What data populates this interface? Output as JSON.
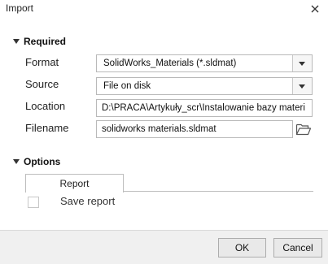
{
  "dialog": {
    "title": "Import"
  },
  "required": {
    "heading": "Required",
    "format": {
      "label": "Format",
      "value": "SolidWorks_Materials (*.sldmat)"
    },
    "source": {
      "label": "Source",
      "value": "File on disk"
    },
    "location": {
      "label": "Location",
      "value": "D:\\PRACA\\Artykuły_scr\\Instalowanie bazy materi"
    },
    "filename": {
      "label": "Filename",
      "value": "solidworks materials.sldmat"
    }
  },
  "options": {
    "heading": "Options",
    "tabs": [
      {
        "label": "Report"
      }
    ],
    "save_report": {
      "label": "Save report",
      "checked": false
    }
  },
  "buttons": {
    "ok": "OK",
    "cancel": "Cancel"
  },
  "icons": {
    "close": "close-icon",
    "folder": "folder-open-icon",
    "dropdown": "chevron-down-icon",
    "section": "triangle-down-icon"
  }
}
